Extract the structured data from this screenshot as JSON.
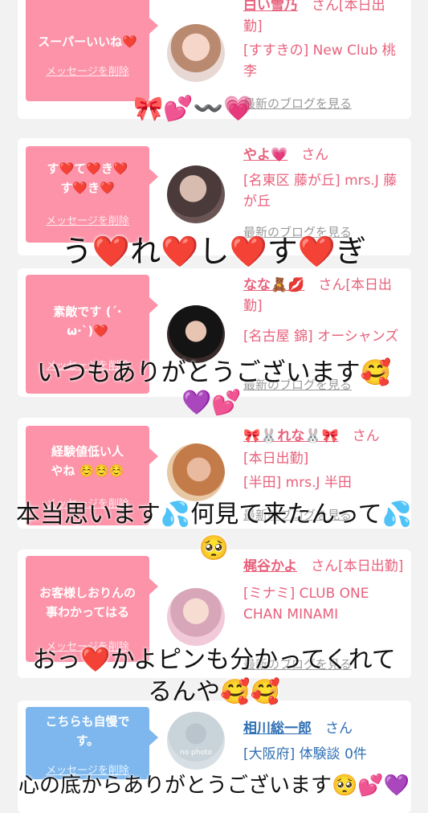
{
  "posts": [
    {
      "message": "スーパーいいね❤️",
      "delete_label": "メッセージを削除",
      "name": "白い雪乃",
      "san": "さん",
      "status": "[本日出勤]",
      "area": "[すすきの] New Club 桃李",
      "blog_label": "最新のブログを見る",
      "avatar_icon": "avatar-photo"
    },
    {
      "message": "す❤️て❤️き❤️す❤️き❤️",
      "delete_label": "メッセージを削除",
      "name": "やよ💗",
      "san": "さん",
      "area": "[名東区 藤が丘] mrs.J 藤が丘",
      "blog_label": "最新のブログを見る",
      "avatar_icon": "avatar-photo"
    },
    {
      "message": "素敵です (´·ω·`)❤️",
      "delete_label": "メッセージを削除",
      "name": "なな🧸💋",
      "san": "さん",
      "status": "[本日出勤]",
      "area": "[名古屋 錦] オーシャンズ",
      "blog_label": "最新のブログを見る",
      "avatar_icon": "avatar-photo"
    },
    {
      "message": "経験値低い人やね ☺️☺️☺️",
      "delete_label": "メッセージを削除",
      "name": "🎀🐰れな🐰🎀",
      "san": "さん",
      "status": "[本日出勤]",
      "area": "[半田] mrs.J 半田",
      "blog_label": "最新のブログを見る",
      "avatar_icon": "avatar-photo"
    },
    {
      "message": "お客様しおりんの事わかってはる",
      "delete_label": "メッセージを削除",
      "name": "梶谷かよ",
      "san": "さん",
      "status": "[本日出勤]",
      "area": "[ミナミ] CLUB ONE CHAN MINAMI",
      "blog_label": "最新のブログを見る",
      "avatar_icon": "avatar-photo"
    },
    {
      "message": "こちらも自慢です。",
      "delete_label": "メッセージを削除",
      "name": "相川総一郎",
      "san": "さん",
      "area": "[大阪府] 体験談 0件",
      "avatar_icon": "no-photo-avatar",
      "avatar_text": "no photo"
    }
  ],
  "overlays": {
    "line1": "う❤️れ❤️し❤️す❤️ぎ",
    "line2": "いつもありがとうございます🥰",
    "line3": "本当思います💦何見て来たんって💦🥺",
    "line4": "おっ❤️かよピンも分かってくれてるんや🥰🥰",
    "line5": "心の底からありがとうございます🥺💕💜",
    "deco_top": "🎀💕〰️💗",
    "deco_mid": "💜💕"
  },
  "colors": {
    "pink_bubble": "#fc93a8",
    "blue_bubble": "#7db7ee",
    "pink_text": "#e8617c",
    "blue_text": "#2f6fb3"
  }
}
